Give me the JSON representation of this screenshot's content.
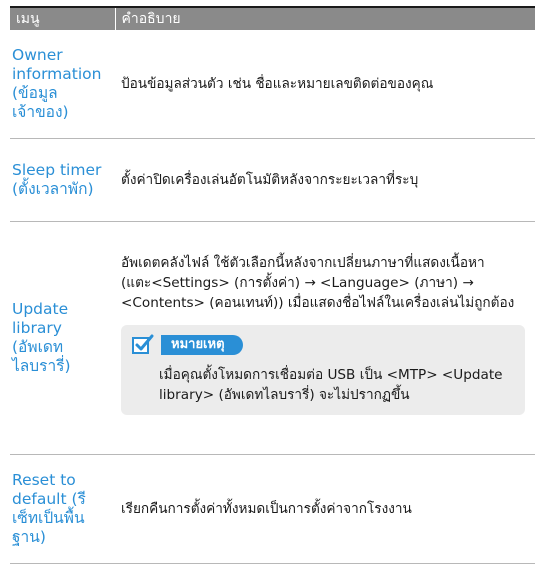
{
  "table": {
    "headers": [
      "เมนู",
      "คำอธิบาย"
    ],
    "rows": [
      {
        "name": "Owner information (ข้อมูลเจ้าของ)",
        "description": "ป้อนข้อมูลส่วนตัว เช่น ชื่อและหมายเลขติดต่อของคุณ"
      },
      {
        "name": "Sleep timer (ตั้งเวลาพัก)",
        "description": "ตั้งค่าปิดเครื่องเล่นอัตโนมัติหลังจากระยะเวลาที่ระบุ"
      },
      {
        "name": "Update library (อัพเดทไลบรารี่)",
        "description": "อัพเดตคลังไฟล์ ใช้ตัวเลือกนี้หลังจากเปลี่ยนภาษาที่แสดงเนื้อหา (แตะ<Settings> (การตั้งค่า) → <Language> (ภาษา) → <Contents> (คอนเทนท์)) เมื่อแสดงชื่อไฟล์ในเครื่องเล่นไม่ถูกต้อง",
        "note": {
          "label": "หมายเหตุ",
          "icon": "note-check-icon",
          "text": "เมื่อคุณตั้งโหมดการเชื่อมต่อ USB เป็น <MTP> <Update library> (อัพเดทไลบรารี่) จะไม่ปรากฏขึ้น"
        }
      },
      {
        "name": "Reset to default (รีเซ็ทเป็นพื้นฐาน)",
        "description": "เรียกคืนการตั้งค่าทั้งหมดเป็นการตั้งค่าจากโรงงาน"
      }
    ]
  },
  "colors": {
    "header_bg": "#8a8a8a",
    "menu_text": "#2a8fd6",
    "note_bg": "#ececec",
    "note_badge": "#2a8fd6"
  }
}
